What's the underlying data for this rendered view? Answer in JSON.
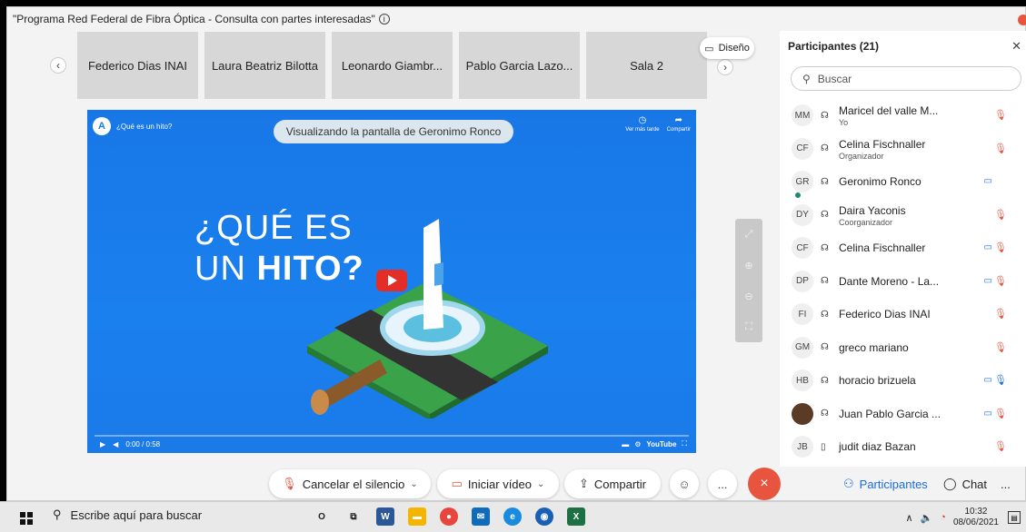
{
  "meeting_title": "\"Programa Red Federal de Fibra Óptica - Consulta con partes interesadas\"",
  "info_symbol": "i",
  "tiles": [
    {
      "label": "Federico Dias INAI"
    },
    {
      "label": "Laura Beatriz Bilotta"
    },
    {
      "label": "Leonardo Giambr..."
    },
    {
      "label": "Pablo Garcia Lazo..."
    },
    {
      "label": "Sala 2"
    }
  ],
  "layout_button": "Diseño",
  "video": {
    "yt_title": "¿Qué es un hito?",
    "watch_later": "Ver más tarde",
    "share": "Compartir",
    "viewing_label": "Visualizando la pantalla de Geronimo Ronco",
    "line1": "¿QUÉ ES",
    "line2_a": "UN ",
    "line2_b": "HITO?",
    "time": "0:00 / 0:58",
    "youtube": "YouTube"
  },
  "panel": {
    "title": "Participantes (21)",
    "search_placeholder": "Buscar",
    "participants": [
      {
        "initials": "MM",
        "name": "Maricel del valle M...",
        "role": "Yo",
        "cam": false,
        "mic": "muted"
      },
      {
        "initials": "CF",
        "name": "Celina Fischnaller",
        "role": "Organizador",
        "cam": false,
        "mic": "muted"
      },
      {
        "initials": "GR",
        "name": "Geronimo Ronco",
        "role": "",
        "cam": true,
        "mic": "none",
        "presence": true
      },
      {
        "initials": "DY",
        "name": "Daira Yaconis",
        "role": "Coorganizador",
        "cam": false,
        "mic": "muted"
      },
      {
        "initials": "CF",
        "name": "Celina Fischnaller",
        "role": "",
        "cam": true,
        "mic": "muted"
      },
      {
        "initials": "DP",
        "name": "Dante Moreno - La...",
        "role": "",
        "cam": true,
        "mic": "muted"
      },
      {
        "initials": "FI",
        "name": "Federico Dias INAI",
        "role": "",
        "cam": false,
        "mic": "muted"
      },
      {
        "initials": "GM",
        "name": "greco mariano",
        "role": "",
        "cam": false,
        "mic": "muted"
      },
      {
        "initials": "HB",
        "name": "horacio brizuela",
        "role": "",
        "cam": true,
        "mic": "on"
      },
      {
        "initials": "",
        "name": "Juan Pablo Garcia ...",
        "role": "",
        "cam": true,
        "mic": "muted",
        "photo": true
      },
      {
        "initials": "JB",
        "name": "judit diaz Bazan",
        "role": "",
        "cam": false,
        "mic": "muted"
      }
    ]
  },
  "toolbar": {
    "mute": "Cancelar el silencio",
    "video": "Iniciar vídeo",
    "share": "Compartir",
    "participants": "Participantes",
    "chat": "Chat",
    "more": "...",
    "end": "×"
  },
  "taskbar": {
    "search": "Escribe aquí para buscar",
    "time": "10:32",
    "date": "08/06/2021"
  },
  "colors": {
    "accent": "#1a6de0",
    "danger": "#e8553e",
    "video_bg": "#1a7ae8"
  }
}
